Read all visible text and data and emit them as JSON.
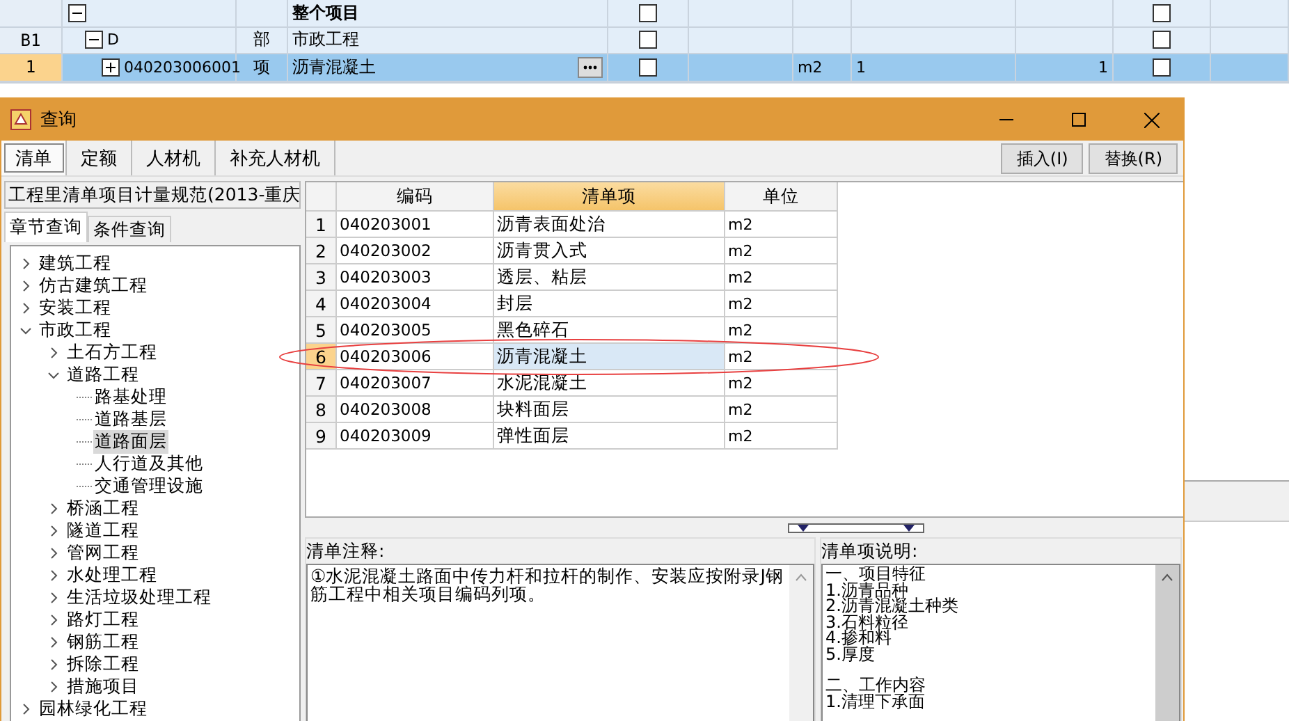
{
  "project_grid": {
    "rows": [
      {
        "name": "整个项目",
        "expanded": true,
        "selected": false,
        "checks": [
          false,
          false
        ],
        "children": [
          {
            "number": "B1",
            "code": "D",
            "type": "部",
            "name": "市政工程",
            "expanded": true,
            "selected": false,
            "checks": [
              false,
              false
            ],
            "children": [
              {
                "number": "1",
                "code": "040203006001",
                "type": "项",
                "name": "沥青混凝土",
                "unit": "m2",
                "quantity": "1",
                "amount": "1",
                "expanded": false,
                "selected": true,
                "checks": [
                  false,
                  false
                ]
              }
            ]
          }
        ]
      }
    ]
  },
  "dialog": {
    "title": "查询",
    "tabs": [
      {
        "label": "清单",
        "selected": true
      },
      {
        "label": "定额",
        "selected": false
      },
      {
        "label": "人材机",
        "selected": false
      },
      {
        "label": "补充人材机",
        "selected": false
      }
    ],
    "buttons": [
      "插入(I)",
      "替换(R)"
    ],
    "standard": "工程里清单项目计量规范(2013-重庆",
    "search_tabs": [
      {
        "label": "章节查询",
        "selected": true
      },
      {
        "label": "条件查询",
        "selected": false
      }
    ],
    "tree": [
      {
        "label": "建筑工程",
        "expanded": false,
        "selected": false
      },
      {
        "label": "仿古建筑工程",
        "expanded": false,
        "selected": false
      },
      {
        "label": "安装工程",
        "expanded": false,
        "selected": false
      },
      {
        "label": "市政工程",
        "expanded": true,
        "selected": false,
        "children": [
          {
            "label": "土石方工程",
            "expanded": false,
            "selected": false
          },
          {
            "label": "道路工程",
            "expanded": true,
            "selected": false,
            "children": [
              {
                "label": "路基处理",
                "selected": false
              },
              {
                "label": "道路基层",
                "selected": false
              },
              {
                "label": "道路面层",
                "selected": true
              },
              {
                "label": "人行道及其他",
                "selected": false
              },
              {
                "label": "交通管理设施",
                "selected": false
              }
            ]
          },
          {
            "label": "桥涵工程",
            "expanded": false,
            "selected": false
          },
          {
            "label": "隧道工程",
            "expanded": false,
            "selected": false
          },
          {
            "label": "管网工程",
            "expanded": false,
            "selected": false
          },
          {
            "label": "水处理工程",
            "expanded": false,
            "selected": false
          },
          {
            "label": "生活垃圾处理工程",
            "expanded": false,
            "selected": false
          },
          {
            "label": "路灯工程",
            "expanded": false,
            "selected": false
          },
          {
            "label": "钢筋工程",
            "expanded": false,
            "selected": false
          },
          {
            "label": "拆除工程",
            "expanded": false,
            "selected": false
          },
          {
            "label": "措施项目",
            "expanded": false,
            "selected": false
          }
        ]
      },
      {
        "label": "园林绿化工程",
        "expanded": false,
        "selected": false
      }
    ],
    "list": {
      "columns": [
        {
          "label": "编码",
          "selected": false
        },
        {
          "label": "清单项",
          "selected": true
        },
        {
          "label": "单位",
          "selected": false
        }
      ],
      "rows": [
        {
          "number": "1",
          "code": "040203001",
          "item": "沥青表面处治",
          "unit": "m2",
          "selected": false
        },
        {
          "number": "2",
          "code": "040203002",
          "item": "沥青贯入式",
          "unit": "m2",
          "selected": false
        },
        {
          "number": "3",
          "code": "040203003",
          "item": "透层、粘层",
          "unit": "m2",
          "selected": false
        },
        {
          "number": "4",
          "code": "040203004",
          "item": "封层",
          "unit": "m2",
          "selected": false
        },
        {
          "number": "5",
          "code": "040203005",
          "item": "黑色碎石",
          "unit": "m2",
          "selected": false
        },
        {
          "number": "6",
          "code": "040203006",
          "item": "沥青混凝土",
          "unit": "m2",
          "selected": true
        },
        {
          "number": "7",
          "code": "040203007",
          "item": "水泥混凝土",
          "unit": "m2",
          "selected": false
        },
        {
          "number": "8",
          "code": "040203008",
          "item": "块料面层",
          "unit": "m2",
          "selected": false
        },
        {
          "number": "9",
          "code": "040203009",
          "item": "弹性面层",
          "unit": "m2",
          "selected": false
        }
      ]
    },
    "notes": {
      "label": "清单注释:",
      "text": "①水泥混凝土路面中传力杆和拉杆的制作、安装应按附录J钢筋工程中相关项目编码列项。"
    },
    "description": {
      "label": "清单项说明:",
      "sections": [
        [
          "一、项目特征",
          "1.沥青品种",
          "2.沥青混凝土种类",
          "3.石料粒径",
          "4.掺和料",
          "5.厚度"
        ],
        [
          "二、工作内容",
          "1.清理下承面"
        ]
      ]
    }
  }
}
